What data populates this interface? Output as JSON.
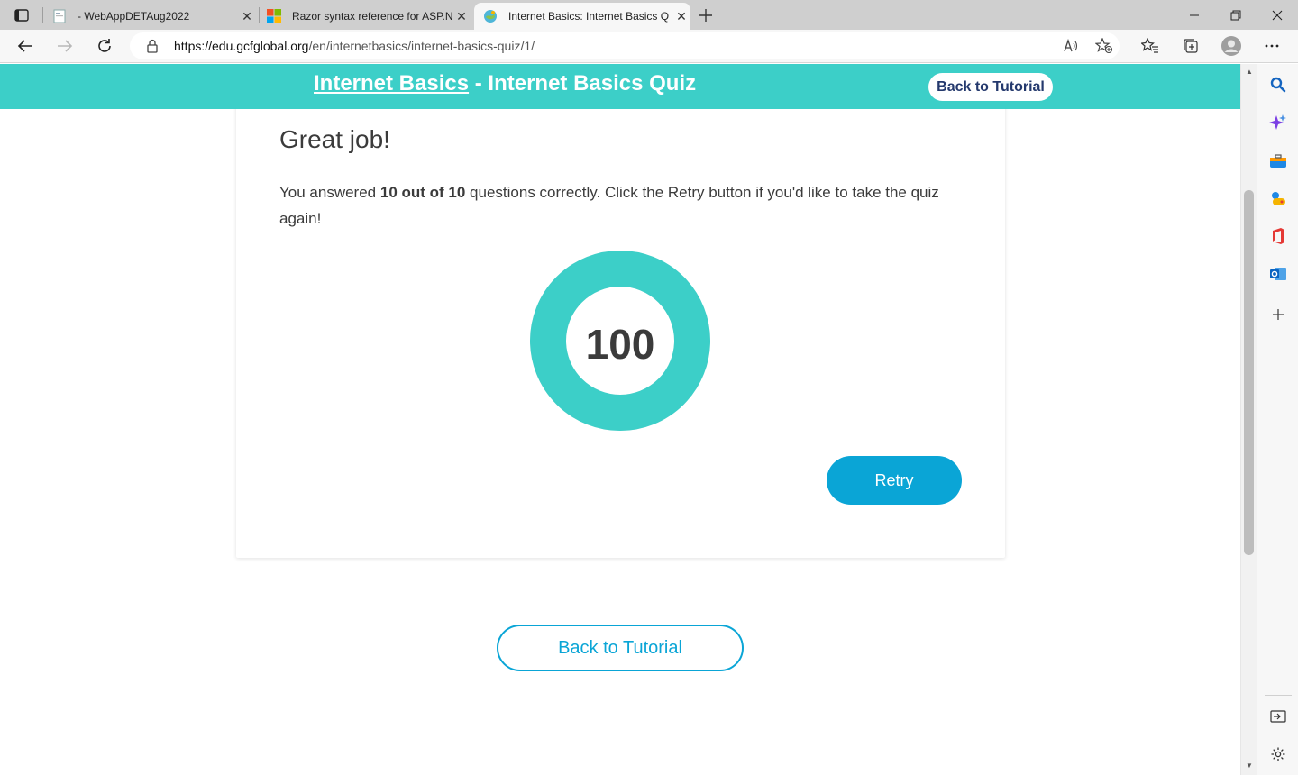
{
  "browser": {
    "tabs": [
      {
        "title": "- WebAppDETAug2022",
        "active": false
      },
      {
        "title": "Razor syntax reference for ASP.N",
        "active": false
      },
      {
        "title": "Internet Basics: Internet Basics Q",
        "active": true
      }
    ],
    "url_host": "https://edu.gcfglobal.org",
    "url_path": "/en/internetbasics/internet-basics-quiz/1/"
  },
  "banner": {
    "course_link": "Internet Basics",
    "separator": " - Internet Basics Quiz",
    "back_button": "Back to Tutorial"
  },
  "result": {
    "heading": "Great job!",
    "message_prefix": "You answered ",
    "message_bold": "10 out of 10",
    "message_suffix": " questions correctly. Click the Retry button if you'd like to take the quiz again!",
    "score": "100",
    "score_fraction": 1.0,
    "retry_label": "Retry"
  },
  "footer": {
    "back_button": "Back to Tutorial"
  },
  "colors": {
    "teal": "#3ccfc8",
    "blue": "#0aa5d6",
    "navy": "#24396d"
  }
}
